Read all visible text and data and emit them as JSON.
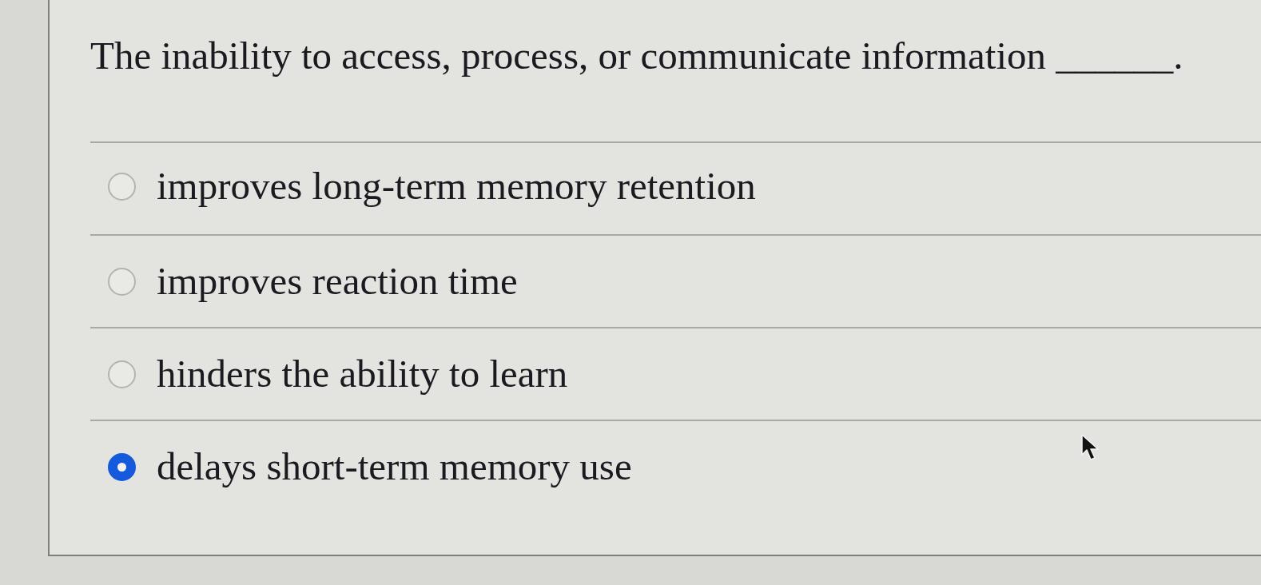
{
  "question": {
    "text": "The inability to access, process, or communicate information ______."
  },
  "options": [
    {
      "label": "improves long-term memory retention",
      "selected": false
    },
    {
      "label": "improves reaction time",
      "selected": false
    },
    {
      "label": "hinders the ability to learn",
      "selected": false
    },
    {
      "label": "delays short-term memory use",
      "selected": true
    }
  ]
}
